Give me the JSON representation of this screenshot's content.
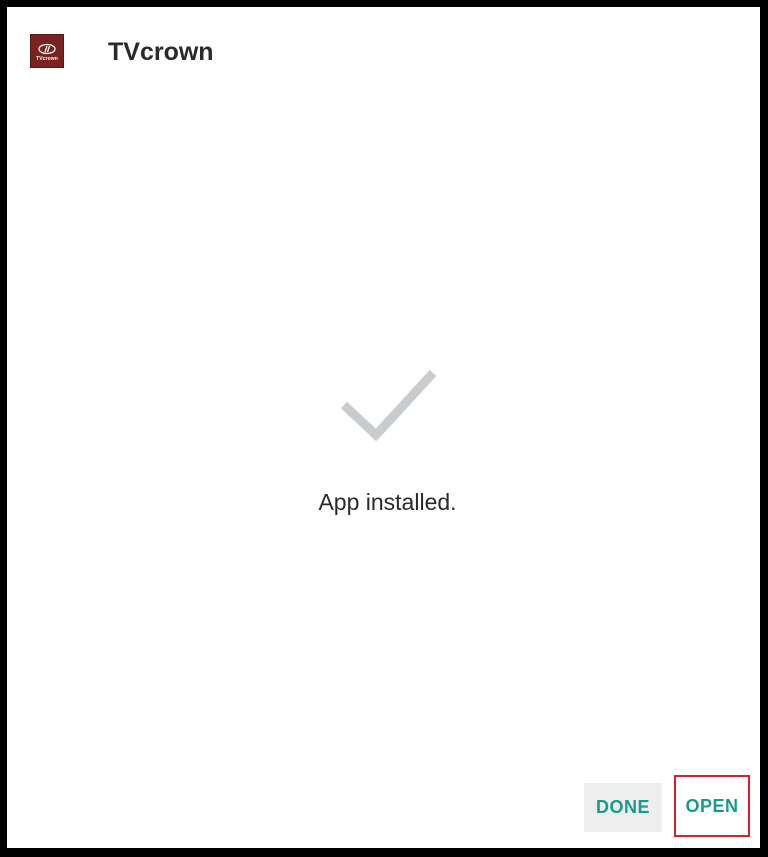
{
  "header": {
    "app_name": "TVcrown",
    "icon": {
      "name": "tvcrown-app-icon",
      "label": "TVcrown",
      "background": "#7a2222"
    }
  },
  "content": {
    "status_icon": "checkmark-icon",
    "status_text": "App installed."
  },
  "actions": {
    "done_label": "DONE",
    "open_label": "OPEN"
  },
  "colors": {
    "accent": "#1a9a8a",
    "check": "#c9ccce",
    "highlight_border": "#d62030",
    "text": "#2a2a2a"
  }
}
